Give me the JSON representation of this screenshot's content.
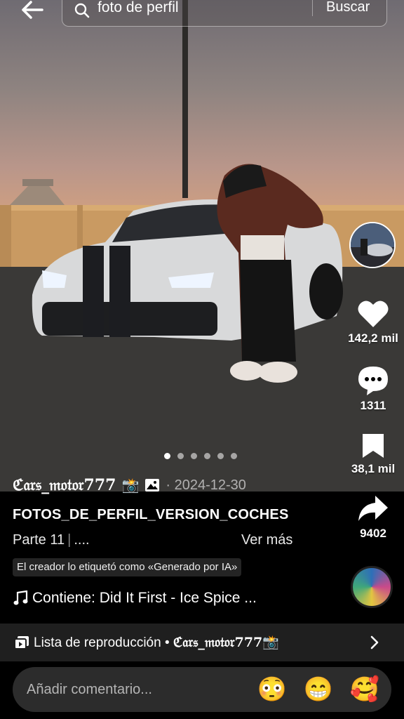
{
  "search": {
    "query": "foto de perfil",
    "button_label": "Buscar"
  },
  "actions": {
    "likes": "142,2 mil",
    "comments": "1311",
    "saves": "38,1 mil",
    "shares": "9402"
  },
  "carousel": {
    "total": 6,
    "active_index": 0
  },
  "post": {
    "author": "ℭ𝔞𝔯𝔰_𝔪𝔬𝔱𝔬𝔯777",
    "author_badge": "📸",
    "date": "· 2024-12-30",
    "title": "FOTOS_DE_PERFIL_VERSION_COCHES",
    "part": "Parte 11",
    "part_suffix": "....",
    "more_label": "Ver más",
    "ai_label": "El creador lo etiquetó como «Generado por IA»",
    "music": "Contiene: Did It First - Ice Spice ..."
  },
  "playlist": {
    "label": "Lista de reproducción • ",
    "brand": "ℭ𝔞𝔯𝔰_𝔪𝔬𝔱𝔬𝔯777📸"
  },
  "comment": {
    "placeholder": "Añadir comentario...",
    "emojis": [
      "😳",
      "😁",
      "🥰"
    ]
  },
  "colors": {
    "background": "#000000",
    "bar": "#1f1f1f",
    "input": "#2c2c2c"
  }
}
